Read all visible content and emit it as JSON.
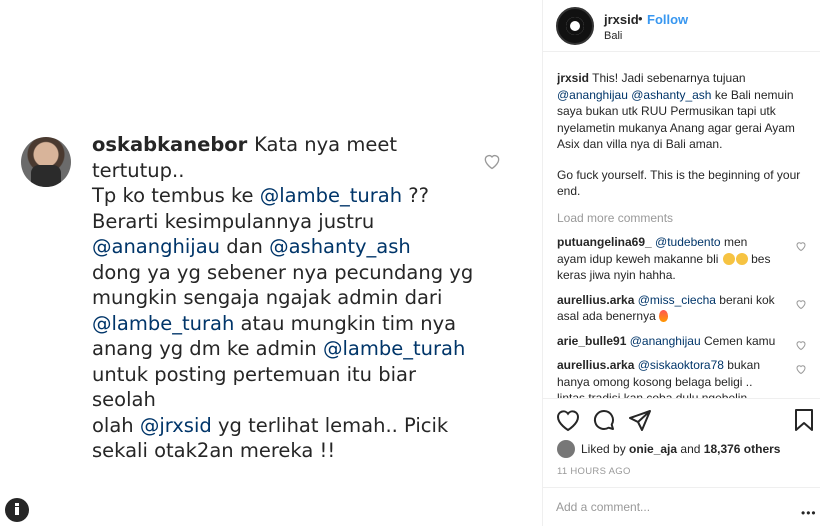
{
  "image": {
    "username": "oskabkanebor",
    "lines": [
      [
        {
          "t": "Kata nya meet tertutup.."
        }
      ],
      [
        {
          "t": "Tp ko tembus ke "
        },
        {
          "t": "@lambe_turah",
          "m": true
        },
        {
          "t": " ??"
        }
      ],
      [
        {
          "t": "Berarti kesimpulannya justru"
        }
      ],
      [
        {
          "t": "@ananghijau",
          "m": true
        },
        {
          "t": " dan "
        },
        {
          "t": "@ashanty_ash",
          "m": true
        }
      ],
      [
        {
          "t": "dong ya yg sebener nya pecundang yg"
        }
      ],
      [
        {
          "t": "mungkin sengaja ngajak admin dari"
        }
      ],
      [
        {
          "t": "@lambe_turah",
          "m": true
        },
        {
          "t": " atau mungkin tim nya"
        }
      ],
      [
        {
          "t": "anang yg dm ke admin "
        },
        {
          "t": "@lambe_turah",
          "m": true
        }
      ],
      [
        {
          "t": "untuk posting pertemuan itu biar seolah"
        }
      ],
      [
        {
          "t": "olah "
        },
        {
          "t": "@jrxsid",
          "m": true
        },
        {
          "t": " yg terlihat lemah.. Picik"
        }
      ],
      [
        {
          "t": "sekali otak2an mereka !!"
        }
      ]
    ]
  },
  "header": {
    "username": "jrxsid",
    "dot": "•",
    "follow": "Follow",
    "location": "Bali"
  },
  "caption": {
    "username": "jrxsid",
    "text1": " This! Jadi sebenarnya tujuan ",
    "mention1": "@ananghijau",
    "mention2": "@ashanty_ash",
    "text2": " ke Bali nemuin saya bukan utk RUU Permusikan tapi utk nyelametin mukanya Anang agar gerai Ayam Asix dan villa nya di Bali aman.",
    "text3": "Go fuck yourself. This is the beginning of your end."
  },
  "load_more": "Load more comments",
  "comments": [
    {
      "user": "putuangelina69_",
      "mention": "@tudebento",
      "text": " men ayam idup keweh makanne bli ",
      "extra": " bes keras jiwa nyin hahha."
    },
    {
      "user": "aurellius.arka",
      "mention": "@miss_ciecha",
      "text": " berani kok asal ada benernya "
    },
    {
      "user": "arie_bulle91",
      "mention": "@ananghijau",
      "text": " Cemen kamu"
    },
    {
      "user": "aurellius.arka",
      "mention": "@siskaoktora78",
      "text": " bukan hanya omong kosong belaga beligi .. lintas tradisi kan coba dulu ngebelin"
    }
  ],
  "likes": {
    "prefix": "Liked by ",
    "user": "onie_aja",
    "middle": " and ",
    "count": "18,376 others"
  },
  "time": "11 HOURS AGO",
  "add_comment_placeholder": "Add a comment...",
  "more": "•••"
}
